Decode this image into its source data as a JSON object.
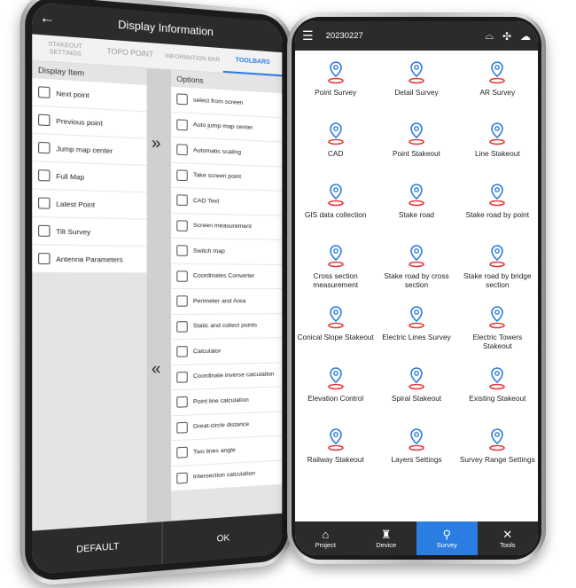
{
  "left": {
    "title": "Display Information",
    "tabs": [
      {
        "label": "STAKEOUT SETTINGS"
      },
      {
        "label": "TOPO POINT"
      },
      {
        "label": "INFORMATION BAR"
      },
      {
        "label": "TOOLBARS",
        "active": true
      }
    ],
    "display_item_header": "Display Item",
    "options_header": "Options",
    "display_items": [
      "Next point",
      "Previous point",
      "Jump map center",
      "Full Map",
      "Latest Point",
      "Tilt Survey",
      "Antenna Parameters"
    ],
    "options": [
      "select from screen",
      "Auto jump map center",
      "Automatic scaling",
      "Take screen point",
      "CAD Text",
      "Screen measurement",
      "Switch map",
      "Coordinates Converter",
      "Perimeter and Area",
      "Static and collect points",
      "Calculator",
      "Coordinate inverse calculation",
      "Point line calculation",
      "Great-circle distance",
      "Two lines angle",
      "Intersection calculation"
    ],
    "add_arrow": "»",
    "remove_arrow": "«",
    "default_label": "DEFAULT",
    "ok_label": "OK"
  },
  "right": {
    "project_name": "20230227",
    "header_icons": [
      "menu-icon",
      "receiver-icon",
      "satellite-icon",
      "cloud-icon"
    ],
    "functions": [
      "Point Survey",
      "Detail Survey",
      "AR Survey",
      "CAD",
      "Point Stakeout",
      "Line Stakeout",
      "GIS data collection",
      "Stake road",
      "Stake road by point",
      "Cross section measurement",
      "Stake road by cross section",
      "Stake road by bridge section",
      "Conical Slope Stakeout",
      "Electric Lines Survey",
      "Electric Towers Stakeout",
      "Elevation Control",
      "Spiral Stakeout",
      "Existing Stakeout",
      "Railway Stakeout",
      "Layers Settings",
      "Survey Range Settings"
    ],
    "nav": [
      {
        "label": "Project",
        "icon": "home-icon"
      },
      {
        "label": "Device",
        "icon": "device-icon"
      },
      {
        "label": "Survey",
        "icon": "pin-icon",
        "active": true
      },
      {
        "label": "Tools",
        "icon": "tools-icon"
      }
    ],
    "colors": {
      "accent": "#2a7de1",
      "icon_red": "#e53935",
      "bar": "#2b2b2b"
    }
  }
}
